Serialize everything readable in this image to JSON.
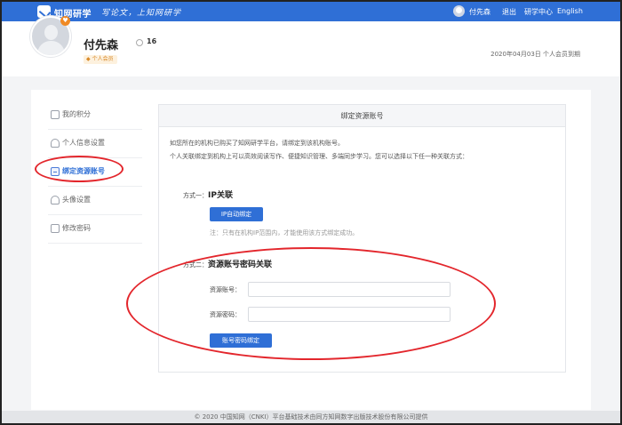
{
  "topbar": {
    "brand": "知网研学",
    "slogan": "写论文，上知网研学",
    "user": "付先森",
    "logout": "退出",
    "center": "研学中心",
    "lang": "English"
  },
  "profile": {
    "name": "付先森",
    "coin_count": "16",
    "member_tag": "个人会员",
    "vip_glyph": "♥",
    "gem_glyph": "◆",
    "expiry": "2020年04月03日 个人会员到期"
  },
  "sidebar": {
    "items": [
      {
        "label": "我的积分",
        "icon": "points-icon"
      },
      {
        "label": "个人信息设置",
        "icon": "user-icon"
      },
      {
        "label": "绑定资源账号",
        "icon": "document-icon"
      },
      {
        "label": "头像设置",
        "icon": "avatar-icon"
      },
      {
        "label": "修改密码",
        "icon": "lock-icon"
      }
    ],
    "active_index": 2
  },
  "panel": {
    "title": "绑定资源账号",
    "desc1": "如您所在的机构已购买了知网研学平台，请绑定到该机构账号。",
    "desc2": "个人关联绑定到机构上可以高效阅读写作、便捷知识管理、多端同步学习。您可以选择以下任一种关联方式：",
    "method1_prefix": "方式一：",
    "method1_title": "IP关联",
    "ip_button": "IP自动绑定",
    "note": "注：只有在机构IP范围内，才能使用该方式绑定成功。",
    "method2_prefix": "方式二：",
    "method2_title": "资源账号密码关联",
    "account_label": "资源账号：",
    "account_value": "",
    "password_label": "资源密码：",
    "password_value": "",
    "bind_button": "账号密码绑定"
  },
  "footer": {
    "text": "© 2020 中国知网（CNKI）平台基础技术由同方知网数字出版技术股份有限公司提供"
  },
  "colors": {
    "primary": "#2f6fd6",
    "annotation_red": "#e3262c",
    "vip_orange": "#f08a24"
  }
}
